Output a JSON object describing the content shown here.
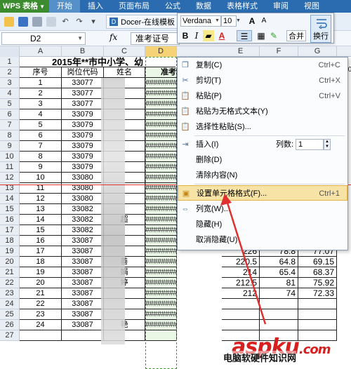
{
  "app": {
    "title": "WPS 表格",
    "menu_tabs": [
      "开始",
      "插入",
      "页面布局",
      "公式",
      "数据",
      "表格样式",
      "审阅",
      "视图"
    ]
  },
  "toolbar": {
    "docer_tab": "Docer-在线模板"
  },
  "formula_bar": {
    "name_box": "D2",
    "fx": "fx",
    "formula": "准考证号",
    "extra": "01506"
  },
  "mini_toolbar": {
    "font_name": "Verdana",
    "font_size": "10",
    "merge_label": "合并",
    "wrap_label": "换行",
    "bold": "B",
    "italic": "I",
    "underline": "U",
    "font_color_letter": "A",
    "grow": "A",
    "shrink": "A"
  },
  "columns": [
    "A",
    "B",
    "C",
    "D",
    "E",
    "F",
    "G"
  ],
  "sheet": {
    "title": "2015年**市中小学、幼",
    "headers": [
      "序号",
      "岗位代码",
      "姓名",
      "准考"
    ],
    "rows": [
      {
        "r": "3",
        "seq": "1",
        "code": "33077",
        "name": "",
        "d": "#########",
        "e": "",
        "f": "",
        "g": ""
      },
      {
        "r": "4",
        "seq": "2",
        "code": "33077",
        "name": "",
        "d": "#########",
        "e": "",
        "f": "",
        "g": ""
      },
      {
        "r": "5",
        "seq": "3",
        "code": "33077",
        "name": "",
        "d": "#########",
        "e": "",
        "f": "",
        "g": ""
      },
      {
        "r": "6",
        "seq": "4",
        "code": "33079",
        "name": "",
        "d": "#########",
        "e": "",
        "f": "",
        "g": ""
      },
      {
        "r": "7",
        "seq": "5",
        "code": "33079",
        "name": "",
        "d": "#########",
        "e": "",
        "f": "",
        "g": ""
      },
      {
        "r": "8",
        "seq": "6",
        "code": "33079",
        "name": "",
        "d": "#########",
        "e": "",
        "f": "",
        "g": ""
      },
      {
        "r": "9",
        "seq": "7",
        "code": "33079",
        "name": "",
        "d": "#########",
        "e": "",
        "f": "",
        "g": ""
      },
      {
        "r": "10",
        "seq": "8",
        "code": "33079",
        "name": "",
        "d": "#########",
        "e": "",
        "f": "",
        "g": ""
      },
      {
        "r": "11",
        "seq": "9",
        "code": "33079",
        "name": "",
        "d": "#########",
        "e": "",
        "f": "",
        "g": ""
      },
      {
        "r": "12",
        "seq": "10",
        "code": "33080",
        "name": "",
        "d": "#########",
        "e": "",
        "f": "",
        "g": ""
      },
      {
        "r": "13",
        "seq": "11",
        "code": "33080",
        "name": "",
        "d": "#########",
        "e": "",
        "f": "",
        "g": ""
      },
      {
        "r": "14",
        "seq": "12",
        "code": "33080",
        "name": "",
        "d": "#########",
        "e": "",
        "f": "",
        "g": ""
      },
      {
        "r": "15",
        "seq": "13",
        "code": "33082",
        "name": "",
        "d": "#########",
        "e": "",
        "f": "",
        "g": ""
      },
      {
        "r": "16",
        "seq": "14",
        "code": "33082",
        "name": "超",
        "d": "#########",
        "e": "",
        "f": "",
        "g": ""
      },
      {
        "r": "17",
        "seq": "15",
        "code": "33082",
        "name": "",
        "d": "#########",
        "e": "",
        "f": "",
        "g": ""
      },
      {
        "r": "18",
        "seq": "16",
        "code": "33087",
        "name": "",
        "d": "#########",
        "e": "228",
        "f": "73",
        "g": "74.5"
      },
      {
        "r": "19",
        "seq": "17",
        "code": "33087",
        "name": "",
        "d": "#########",
        "e": "226",
        "f": "78.8",
        "g": "77.07"
      },
      {
        "r": "20",
        "seq": "18",
        "code": "33087",
        "name": "善",
        "d": "#########",
        "e": "220.5",
        "f": "64.8",
        "g": "69.15"
      },
      {
        "r": "21",
        "seq": "19",
        "code": "33087",
        "name": "娟",
        "d": "#########",
        "e": "214",
        "f": "65.4",
        "g": "68.37"
      },
      {
        "r": "22",
        "seq": "20",
        "code": "33087",
        "name": "婷",
        "d": "#########",
        "e": "212.5",
        "f": "81",
        "g": "75.92"
      },
      {
        "r": "23",
        "seq": "21",
        "code": "33087",
        "name": "",
        "d": "#########",
        "e": "212",
        "f": "74",
        "g": "72.33"
      },
      {
        "r": "24",
        "seq": "22",
        "code": "33087",
        "name": "",
        "d": "#########",
        "e": "",
        "f": "",
        "g": ""
      },
      {
        "r": "25",
        "seq": "23",
        "code": "33087",
        "name": "",
        "d": "#########",
        "e": "",
        "f": "",
        "g": ""
      },
      {
        "r": "26",
        "seq": "24",
        "code": "33087",
        "name": "艳",
        "d": "#########",
        "e": "",
        "f": "",
        "g": ""
      },
      {
        "r": "27",
        "seq": "",
        "code": "",
        "name": "",
        "d": "",
        "e": "",
        "f": "",
        "g": ""
      }
    ],
    "row_header_1": "1",
    "row_header_2": "2"
  },
  "context_menu": {
    "copy": {
      "label": "复制(C)",
      "shortcut": "Ctrl+C"
    },
    "cut": {
      "label": "剪切(T)",
      "shortcut": "Ctrl+X"
    },
    "paste": {
      "label": "粘贴(P)",
      "shortcut": "Ctrl+V"
    },
    "paste_plain": {
      "label": "粘贴为无格式文本(Y)"
    },
    "paste_special": {
      "label": "选择性粘贴(S)..."
    },
    "insert": {
      "label": "插入(I)",
      "cols_label": "列数:",
      "cols_value": "1"
    },
    "delete": {
      "label": "删除(D)"
    },
    "clear": {
      "label": "清除内容(N)"
    },
    "format_cells": {
      "label": "设置单元格格式(F)...",
      "shortcut": "Ctrl+1"
    },
    "col_width": {
      "label": "列宽(W)..."
    },
    "hide": {
      "label": "隐藏(H)"
    },
    "unhide": {
      "label": "取消隐藏(U)"
    }
  },
  "watermark": {
    "brand": "aspku",
    "dot": ".",
    "tld": "com",
    "cn": "电脑软硬件知识网"
  },
  "colors": {
    "title_bar": "#2b6cb0",
    "app_badge": "#3d8b2f",
    "selection": "#f6d277",
    "menu_highlight": "#f7e3a6",
    "arrow": "#e03030"
  }
}
